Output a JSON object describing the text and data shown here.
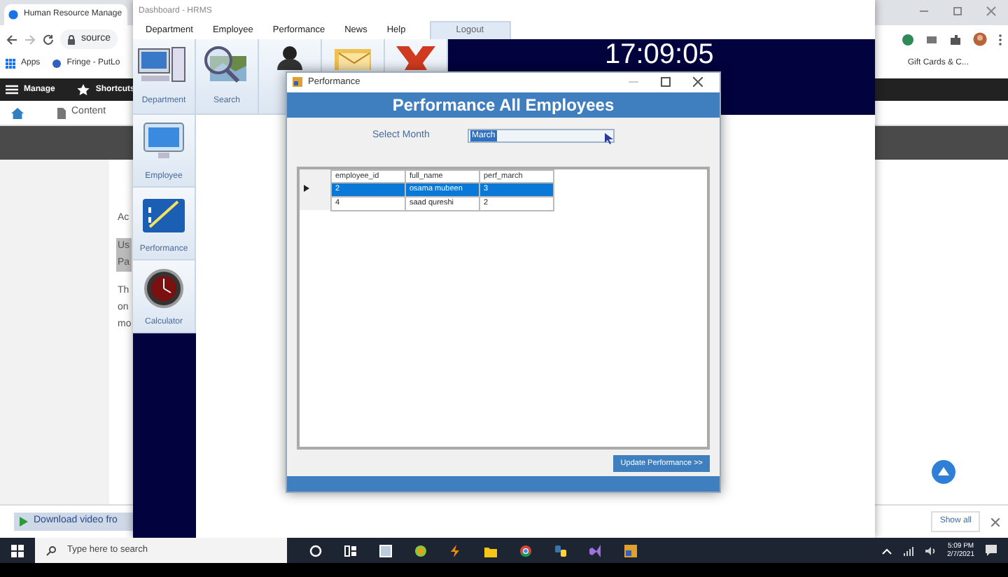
{
  "browser": {
    "tab_title": "Human Resource Manage",
    "address": "source",
    "bookmarks": [
      "Apps",
      "Fringe - PutLo"
    ],
    "bookmark_right": "Gift Cards & C...",
    "toolbar": [
      "Manage",
      "Shortcuts"
    ],
    "content_link": "Content",
    "page_paragraphs": [
      {
        "lines": [
          "Ac"
        ],
        "highlighted": false
      },
      {
        "lines": [
          "Us",
          "Pa"
        ],
        "highlighted": true
      },
      {
        "lines": [
          "Th",
          "on",
          "mo"
        ],
        "highlighted": false
      }
    ],
    "download": "Download video fro",
    "show_all": "Show all"
  },
  "hrms": {
    "title": "Dashboard - HRMS",
    "menu": [
      {
        "label": "Department",
        "kind": "menu"
      },
      {
        "label": "Employee",
        "kind": "menu"
      },
      {
        "label": "Performance",
        "kind": "menu"
      },
      {
        "label": "News",
        "kind": "menu"
      },
      {
        "label": "Help",
        "kind": "menu"
      },
      {
        "label": "Logout",
        "kind": "button"
      }
    ],
    "toolbar": [
      "Department",
      "Search"
    ],
    "clock": "17:09:05",
    "sidebar": [
      "Employee",
      "Performance",
      "Calculator"
    ]
  },
  "dialog": {
    "title": "Performance",
    "header": "Performance All Employees",
    "month_label": "Select Month",
    "month_value": "March",
    "columns": [
      "employee_id",
      "full_name",
      "perf_march"
    ],
    "rows": [
      {
        "cells": [
          "2",
          "osama mubeen",
          "3"
        ],
        "selected": true
      },
      {
        "cells": [
          "4",
          "saad qureshi",
          "2"
        ],
        "selected": false
      }
    ],
    "button": "Update Performance >>"
  },
  "taskbar": {
    "search_placeholder": "Type here to search",
    "time": "5:09 PM",
    "date": "2/7/2021"
  }
}
